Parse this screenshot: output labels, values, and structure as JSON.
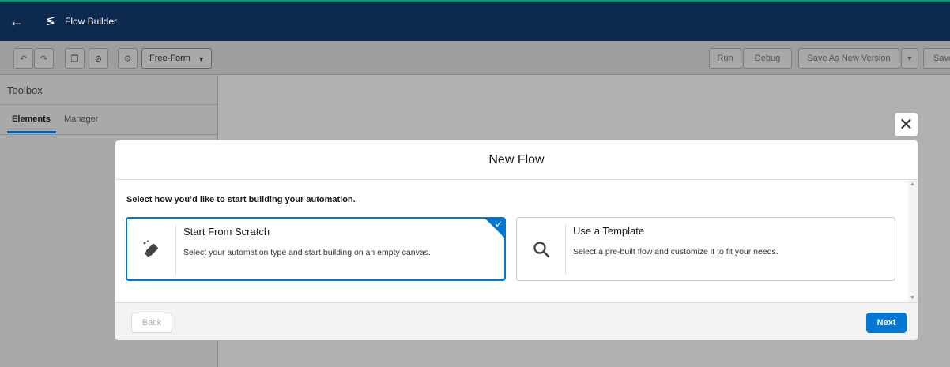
{
  "topbar": {
    "title": "Flow Builder",
    "back_icon": "←",
    "flow_icon": "≶"
  },
  "toolbar": {
    "undo_icon": "↶",
    "redo_icon": "↷",
    "copy_icon": "❐",
    "debug_stop_icon": "⊘",
    "settings_icon": "⚙",
    "layout_value": "Free-Form",
    "run_label": "Run",
    "debug_label": "Debug",
    "save_as_new_label": "Save As New Version",
    "save_label": "Save"
  },
  "sidebar": {
    "title": "Toolbox",
    "tabs": [
      {
        "label": "Elements"
      },
      {
        "label": "Manager"
      }
    ]
  },
  "modal": {
    "title": "New Flow",
    "instruction": "Select how you’d like to start building your automation.",
    "close_icon": "✕",
    "options": [
      {
        "title": "Start From Scratch",
        "description": "Select your automation type and start building on an empty canvas.",
        "selected": true
      },
      {
        "title": "Use a Template",
        "description": "Select a pre-built flow and customize it to fit your needs.",
        "selected": false
      }
    ],
    "back_label": "Back",
    "next_label": "Next"
  },
  "colors": {
    "brand_blue": "#0176d3",
    "header_navy": "#0d2a4e",
    "overlay_gray": "#b0b0b0"
  }
}
